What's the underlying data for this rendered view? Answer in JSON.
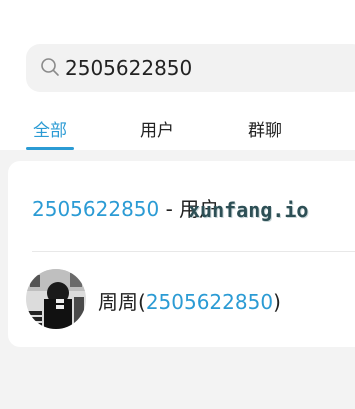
{
  "search": {
    "value": "2505622850"
  },
  "tabs": [
    {
      "label": "全部",
      "active": true
    },
    {
      "label": "用户",
      "active": false
    },
    {
      "label": "群聊",
      "active": false
    }
  ],
  "results": {
    "keyword_result": {
      "highlight": "2505622850",
      "suffix": " - 用户"
    },
    "user_result": {
      "name": "周周",
      "open_paren": "(",
      "highlight": "2505622850",
      "close_paren": ")"
    }
  },
  "watermark": "xunfang.io",
  "colors": {
    "accent": "#2b9bd4",
    "background": "#f3f3f3",
    "card": "#ffffff"
  },
  "icons": [
    "search-icon",
    "avatar"
  ]
}
